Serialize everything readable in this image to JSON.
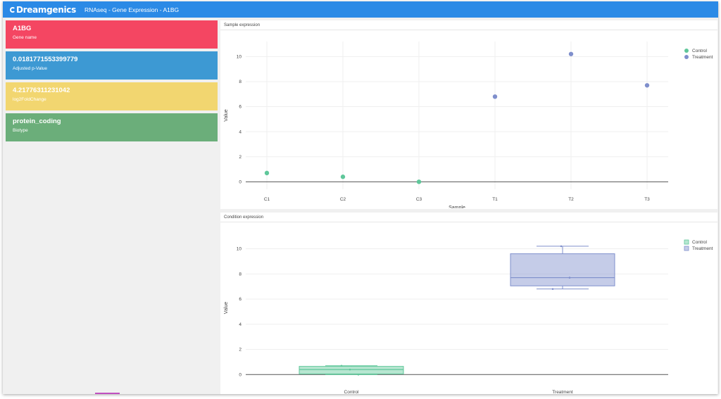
{
  "header": {
    "logo_text": "Dreamgenics",
    "title": "RNAseq - Gene Expression - A1BG"
  },
  "cards": [
    {
      "value": "A1BG",
      "label": "Gene name",
      "color": "#f44662"
    },
    {
      "value": "0.0181771553399779",
      "label": "Adjusted p-Value",
      "color": "#3d99d3"
    },
    {
      "value": "4.21776311231042",
      "label": "log2FoldChange",
      "color": "#f2d670"
    },
    {
      "value": "protein_coding",
      "label": "Biotype",
      "color": "#6bae7a"
    }
  ],
  "colors": {
    "control": "#5fc79a",
    "treatment": "#7f8fcc"
  },
  "panels": {
    "sample_title": "Sample expression",
    "condition_title": "Condition expression"
  },
  "chart_data": [
    {
      "type": "scatter",
      "title": "Sample expression",
      "xlabel": "Sample",
      "ylabel": "Value",
      "categories": [
        "C1",
        "C2",
        "C3",
        "T1",
        "T2",
        "T3"
      ],
      "ylim": [
        -0.6,
        11.2
      ],
      "yticks": [
        0,
        2,
        4,
        6,
        8,
        10
      ],
      "grid": true,
      "legend": "top-right",
      "series": [
        {
          "name": "Control",
          "x": [
            "C1",
            "C2",
            "C3"
          ],
          "values": [
            0.7,
            0.4,
            0.0
          ]
        },
        {
          "name": "Treatment",
          "x": [
            "T1",
            "T2",
            "T3"
          ],
          "values": [
            6.8,
            10.2,
            7.7
          ]
        }
      ]
    },
    {
      "type": "box",
      "title": "Condition expression",
      "xlabel": "",
      "ylabel": "Value",
      "categories": [
        "Control",
        "Treatment"
      ],
      "ylim": [
        -0.6,
        11.2
      ],
      "yticks": [
        0,
        2,
        4,
        6,
        8,
        10
      ],
      "grid": true,
      "legend": "top-right",
      "series": [
        {
          "name": "Control",
          "points": [
            0.7,
            0.4,
            0.0
          ],
          "min": 0.0,
          "q1": 0.05,
          "median": 0.4,
          "q3": 0.65,
          "max": 0.7
        },
        {
          "name": "Treatment",
          "points": [
            6.8,
            10.2,
            7.7
          ],
          "min": 6.8,
          "q1": 7.05,
          "median": 7.7,
          "q3": 9.6,
          "max": 10.2
        }
      ]
    }
  ]
}
